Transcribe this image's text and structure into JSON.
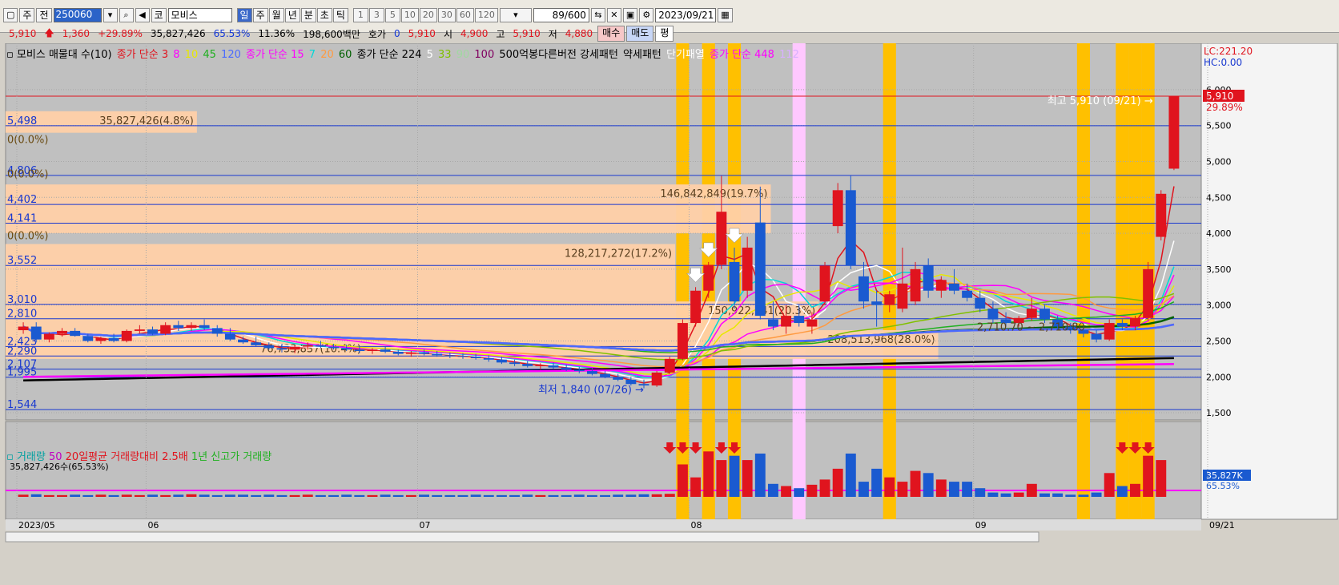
{
  "toolbar": {
    "btn_ju": "주",
    "btn_jeon": "전",
    "stock_code": "250060",
    "market_tag": "코",
    "stock_name": "모비스",
    "periods": [
      "일",
      "주",
      "월",
      "년",
      "분",
      "초",
      "틱"
    ],
    "active_period": "일",
    "numbers": [
      "1",
      "3",
      "5",
      "10",
      "20",
      "30",
      "60",
      "120"
    ],
    "count": "89/600",
    "date": "2023/09/21"
  },
  "quote": {
    "price": "5,910",
    "change": "1,360",
    "change_pct": "+29.89%",
    "volume": "35,827,426",
    "volume_pct": "65.53%",
    "turnover": "11.36%",
    "amount": "198,600백만",
    "hoga_label": "호가",
    "hoga_value": "0",
    "current": "5,910",
    "open_label": "시",
    "open": "4,900",
    "high_label": "고",
    "high": "5,910",
    "low_label": "저",
    "low": "4,880",
    "buy": "매수",
    "sell": "매도",
    "eval": "평"
  },
  "legend": [
    {
      "text": "모비스 매물대 수(10)",
      "color": "#000000"
    },
    {
      "text": "종가 단순 3",
      "color": "#e0141e"
    },
    {
      "text": "8",
      "color": "#ff00ff"
    },
    {
      "text": "10",
      "color": "#e8e800"
    },
    {
      "text": "45",
      "color": "#20b020"
    },
    {
      "text": "120",
      "color": "#4a6aff"
    },
    {
      "text": "종가 단순 15",
      "color": "#ff00ff"
    },
    {
      "text": "7",
      "color": "#00d8d8"
    },
    {
      "text": "20",
      "color": "#ff9a40"
    },
    {
      "text": "60",
      "color": "#006000"
    },
    {
      "text": "종가 단순 224",
      "color": "#000000"
    },
    {
      "text": "5",
      "color": "#ffffff"
    },
    {
      "text": "33",
      "color": "#80c000"
    },
    {
      "text": "90",
      "color": "#a0d8a0"
    },
    {
      "text": "100",
      "color": "#800060"
    },
    {
      "text": "500억봉다른버전 강세패턴",
      "color": "#000000"
    },
    {
      "text": "약세패턴",
      "color": "#000000"
    },
    {
      "text": "단기패열",
      "color": "#ffffff"
    },
    {
      "text": "종가 단순 448",
      "color": "#ff00ff"
    },
    {
      "text": "112",
      "color": "#d8b0ff"
    }
  ],
  "volume_legend": [
    {
      "text": "거래량",
      "color": "#00a0a0"
    },
    {
      "text": "50",
      "color": "#c000c0"
    },
    {
      "text": "20일평균 거래량대비 2.5배",
      "color": "#e0141e"
    },
    {
      "text": "1년 신고가 거래량",
      "color": "#20b020"
    }
  ],
  "volume_sub": "35,827,426수(65.53%)",
  "chart_data": {
    "type": "candlestick",
    "ylim": [
      1400,
      6200
    ],
    "price_ticks": [
      "1,500",
      "2,000",
      "2,500",
      "3,000",
      "3,500",
      "4,000",
      "4,500",
      "5,000",
      "5,500",
      "6,000"
    ],
    "price_tick_values": [
      1500,
      2000,
      2500,
      3000,
      3500,
      4000,
      4500,
      5000,
      5500,
      6000
    ],
    "x_labels": [
      {
        "label": "2023/05",
        "index": 0
      },
      {
        "label": "06",
        "index": 10
      },
      {
        "label": "07",
        "index": 31
      },
      {
        "label": "08",
        "index": 52
      },
      {
        "label": "09",
        "index": 74
      },
      {
        "label": "09/21",
        "index": 88
      }
    ],
    "top_right": {
      "lc": "LC:221.20",
      "hc": "HC:0.00"
    },
    "last_price_tag": "5,910",
    "last_pct_tag": "29.89%",
    "volume_tag": "35,827K",
    "volume_pct_tag": "65.53%",
    "candles": [
      {
        "o": 2650,
        "h": 2760,
        "l": 2600,
        "c": 2700
      },
      {
        "o": 2700,
        "h": 2760,
        "l": 2480,
        "c": 2520
      },
      {
        "o": 2520,
        "h": 2620,
        "l": 2480,
        "c": 2600
      },
      {
        "o": 2600,
        "h": 2680,
        "l": 2560,
        "c": 2640
      },
      {
        "o": 2640,
        "h": 2680,
        "l": 2560,
        "c": 2570
      },
      {
        "o": 2570,
        "h": 2600,
        "l": 2480,
        "c": 2500
      },
      {
        "o": 2500,
        "h": 2560,
        "l": 2460,
        "c": 2540
      },
      {
        "o": 2540,
        "h": 2600,
        "l": 2480,
        "c": 2500
      },
      {
        "o": 2500,
        "h": 2660,
        "l": 2480,
        "c": 2640
      },
      {
        "o": 2640,
        "h": 2720,
        "l": 2600,
        "c": 2660
      },
      {
        "o": 2660,
        "h": 2700,
        "l": 2580,
        "c": 2600
      },
      {
        "o": 2600,
        "h": 2760,
        "l": 2580,
        "c": 2720
      },
      {
        "o": 2720,
        "h": 2780,
        "l": 2640,
        "c": 2680
      },
      {
        "o": 2680,
        "h": 2760,
        "l": 2640,
        "c": 2720
      },
      {
        "o": 2720,
        "h": 2800,
        "l": 2650,
        "c": 2680
      },
      {
        "o": 2680,
        "h": 2720,
        "l": 2560,
        "c": 2600
      },
      {
        "o": 2600,
        "h": 2680,
        "l": 2500,
        "c": 2520
      },
      {
        "o": 2520,
        "h": 2560,
        "l": 2460,
        "c": 2480
      },
      {
        "o": 2480,
        "h": 2560,
        "l": 2420,
        "c": 2440
      },
      {
        "o": 2440,
        "h": 2480,
        "l": 2380,
        "c": 2400
      },
      {
        "o": 2400,
        "h": 2460,
        "l": 2340,
        "c": 2380
      },
      {
        "o": 2380,
        "h": 2440,
        "l": 2330,
        "c": 2420
      },
      {
        "o": 2420,
        "h": 2480,
        "l": 2380,
        "c": 2440
      },
      {
        "o": 2440,
        "h": 2500,
        "l": 2400,
        "c": 2420
      },
      {
        "o": 2420,
        "h": 2460,
        "l": 2380,
        "c": 2400
      },
      {
        "o": 2400,
        "h": 2450,
        "l": 2360,
        "c": 2380
      },
      {
        "o": 2380,
        "h": 2420,
        "l": 2330,
        "c": 2360
      },
      {
        "o": 2360,
        "h": 2400,
        "l": 2320,
        "c": 2380
      },
      {
        "o": 2380,
        "h": 2420,
        "l": 2330,
        "c": 2350
      },
      {
        "o": 2350,
        "h": 2380,
        "l": 2300,
        "c": 2320
      },
      {
        "o": 2320,
        "h": 2360,
        "l": 2280,
        "c": 2340
      },
      {
        "o": 2340,
        "h": 2380,
        "l": 2300,
        "c": 2320
      },
      {
        "o": 2320,
        "h": 2360,
        "l": 2280,
        "c": 2300
      },
      {
        "o": 2300,
        "h": 2340,
        "l": 2260,
        "c": 2290
      },
      {
        "o": 2290,
        "h": 2330,
        "l": 2250,
        "c": 2280
      },
      {
        "o": 2280,
        "h": 2320,
        "l": 2240,
        "c": 2260
      },
      {
        "o": 2260,
        "h": 2300,
        "l": 2210,
        "c": 2240
      },
      {
        "o": 2240,
        "h": 2280,
        "l": 2180,
        "c": 2200
      },
      {
        "o": 2200,
        "h": 2240,
        "l": 2150,
        "c": 2180
      },
      {
        "o": 2180,
        "h": 2220,
        "l": 2130,
        "c": 2150
      },
      {
        "o": 2150,
        "h": 2190,
        "l": 2100,
        "c": 2160
      },
      {
        "o": 2160,
        "h": 2200,
        "l": 2110,
        "c": 2130
      },
      {
        "o": 2130,
        "h": 2170,
        "l": 2080,
        "c": 2100
      },
      {
        "o": 2100,
        "h": 2140,
        "l": 2050,
        "c": 2080
      },
      {
        "o": 2080,
        "h": 2120,
        "l": 2020,
        "c": 2040
      },
      {
        "o": 2040,
        "h": 2080,
        "l": 1980,
        "c": 2000
      },
      {
        "o": 2000,
        "h": 2040,
        "l": 1940,
        "c": 1960
      },
      {
        "o": 1960,
        "h": 2000,
        "l": 1880,
        "c": 1900
      },
      {
        "o": 1900,
        "h": 1960,
        "l": 1840,
        "c": 1880
      },
      {
        "o": 1880,
        "h": 2080,
        "l": 1860,
        "c": 2060
      },
      {
        "o": 2060,
        "h": 2280,
        "l": 2040,
        "c": 2250
      },
      {
        "o": 2250,
        "h": 2800,
        "l": 2230,
        "c": 2750
      },
      {
        "o": 2750,
        "h": 3250,
        "l": 2700,
        "c": 3200
      },
      {
        "o": 3200,
        "h": 3600,
        "l": 3100,
        "c": 3560
      },
      {
        "o": 3560,
        "h": 4800,
        "l": 3500,
        "c": 4300
      },
      {
        "o": 3600,
        "h": 3800,
        "l": 2950,
        "c": 3050
      },
      {
        "o": 3200,
        "h": 3950,
        "l": 3100,
        "c": 3800
      },
      {
        "o": 4150,
        "h": 4650,
        "l": 2800,
        "c": 2850
      },
      {
        "o": 2800,
        "h": 3050,
        "l": 2650,
        "c": 2700
      },
      {
        "o": 2700,
        "h": 3000,
        "l": 2600,
        "c": 2850
      },
      {
        "o": 2850,
        "h": 3000,
        "l": 2700,
        "c": 2750
      },
      {
        "o": 2700,
        "h": 2900,
        "l": 2600,
        "c": 2800
      },
      {
        "o": 3050,
        "h": 3600,
        "l": 3000,
        "c": 3550
      },
      {
        "o": 4100,
        "h": 4700,
        "l": 4000,
        "c": 4600
      },
      {
        "o": 4600,
        "h": 4800,
        "l": 3500,
        "c": 3550
      },
      {
        "o": 3400,
        "h": 3600,
        "l": 2950,
        "c": 3050
      },
      {
        "o": 3050,
        "h": 3200,
        "l": 2700,
        "c": 3000
      },
      {
        "o": 3000,
        "h": 3200,
        "l": 2900,
        "c": 3150
      },
      {
        "o": 2950,
        "h": 3800,
        "l": 2900,
        "c": 3300
      },
      {
        "o": 3050,
        "h": 3600,
        "l": 3000,
        "c": 3500
      },
      {
        "o": 3550,
        "h": 3650,
        "l": 3100,
        "c": 3200
      },
      {
        "o": 3200,
        "h": 3400,
        "l": 3100,
        "c": 3350
      },
      {
        "o": 3300,
        "h": 3500,
        "l": 3150,
        "c": 3200
      },
      {
        "o": 3200,
        "h": 3300,
        "l": 3050,
        "c": 3100
      },
      {
        "o": 3100,
        "h": 3200,
        "l": 2900,
        "c": 2950
      },
      {
        "o": 2950,
        "h": 3050,
        "l": 2750,
        "c": 2800
      },
      {
        "o": 2800,
        "h": 2900,
        "l": 2700,
        "c": 2750
      },
      {
        "o": 2750,
        "h": 2850,
        "l": 2700,
        "c": 2820
      },
      {
        "o": 2820,
        "h": 3100,
        "l": 2780,
        "c": 2950
      },
      {
        "o": 2950,
        "h": 3000,
        "l": 2750,
        "c": 2800
      },
      {
        "o": 2800,
        "h": 2850,
        "l": 2650,
        "c": 2700
      },
      {
        "o": 2700,
        "h": 2750,
        "l": 2600,
        "c": 2650
      },
      {
        "o": 2650,
        "h": 2700,
        "l": 2550,
        "c": 2600
      },
      {
        "o": 2600,
        "h": 2650,
        "l": 2480,
        "c": 2520
      },
      {
        "o": 2520,
        "h": 2800,
        "l": 2500,
        "c": 2750
      },
      {
        "o": 2750,
        "h": 2800,
        "l": 2650,
        "c": 2700
      },
      {
        "o": 2700,
        "h": 2850,
        "l": 2650,
        "c": 2820
      },
      {
        "o": 2820,
        "h": 3600,
        "l": 2780,
        "c": 3500
      },
      {
        "o": 3950,
        "h": 4600,
        "l": 3900,
        "c": 4550
      },
      {
        "o": 4900,
        "h": 5910,
        "l": 4880,
        "c": 5910
      }
    ],
    "volume_max": 35827426,
    "volumes": [
      0.05,
      0.06,
      0.04,
      0.04,
      0.05,
      0.04,
      0.05,
      0.04,
      0.05,
      0.04,
      0.05,
      0.04,
      0.05,
      0.06,
      0.05,
      0.04,
      0.05,
      0.05,
      0.04,
      0.05,
      0.04,
      0.04,
      0.05,
      0.04,
      0.04,
      0.05,
      0.04,
      0.04,
      0.05,
      0.04,
      0.04,
      0.05,
      0.04,
      0.04,
      0.04,
      0.05,
      0.04,
      0.04,
      0.04,
      0.05,
      0.04,
      0.04,
      0.04,
      0.05,
      0.04,
      0.04,
      0.05,
      0.05,
      0.06,
      0.06,
      0.07,
      0.75,
      0.45,
      1.05,
      0.85,
      0.95,
      0.85,
      1.0,
      0.3,
      0.25,
      0.2,
      0.28,
      0.4,
      0.65,
      1.0,
      0.35,
      0.65,
      0.45,
      0.35,
      0.6,
      0.55,
      0.4,
      0.35,
      0.35,
      0.2,
      0.1,
      0.08,
      0.1,
      0.3,
      0.08,
      0.08,
      0.05,
      0.05,
      0.1,
      0.55,
      0.25,
      0.3,
      0.95,
      0.85
    ],
    "price_levels": [
      {
        "value": 5498,
        "label": "5,498"
      },
      {
        "value": 4806,
        "label": "4,806"
      },
      {
        "value": 4402,
        "label": "4,402"
      },
      {
        "value": 4141,
        "label": "4,141"
      },
      {
        "value": 3552,
        "label": "3,552"
      },
      {
        "value": 3010,
        "label": "3,010"
      },
      {
        "value": 2810,
        "label": "2,810"
      },
      {
        "value": 2423,
        "label": "2,423"
      },
      {
        "value": 2290,
        "label": "2,290"
      },
      {
        "value": 2107,
        "label": "2,107"
      },
      {
        "value": 1995,
        "label": "1,995"
      },
      {
        "value": 1544,
        "label": "1,544"
      }
    ],
    "volume_profile": [
      {
        "y1": 5700,
        "y2": 5400,
        "len": 0.16,
        "label": "35,827,426(4.8%)"
      },
      {
        "y1": 4680,
        "y2": 4000,
        "len": 0.64,
        "label": "146,842,849(19.7%)"
      },
      {
        "y1": 3850,
        "y2": 3050,
        "len": 0.56,
        "label": "128,217,272(17.2%)"
      },
      {
        "y1": 3050,
        "y2": 2650,
        "len": 0.68,
        "label": "150,922,541(20.3%)"
      },
      {
        "y1": 2650,
        "y2": 2250,
        "len": 0.78,
        "label": "208,513,968(28.0%)"
      },
      {
        "y1": 2520,
        "y2": 2300,
        "len": 0.3,
        "label": "76,733,837(10.4%)"
      }
    ],
    "zero_labels": [
      {
        "value": 5300,
        "label": "0(0.0%)"
      },
      {
        "value": 4820,
        "label": "0(0.0%)"
      },
      {
        "value": 3960,
        "label": "0(0.0%)"
      }
    ],
    "annotations": [
      {
        "text": "최고 5,910 (09/21) →",
        "value": 5910,
        "index": 88
      },
      {
        "text": "최저 1,840 (07/26) →",
        "value": 1840,
        "index": 48
      },
      {
        "text": "2,710.70 ~ 2,710.80",
        "value": 2710,
        "index": 75
      }
    ],
    "highlight_columns": [
      {
        "index": 51,
        "color": "#ffc000"
      },
      {
        "index": 53,
        "color": "#ffc000"
      },
      {
        "index": 55,
        "color": "#ffc000"
      },
      {
        "index": 60,
        "color": "#ffc8ff"
      },
      {
        "index": 67,
        "color": "#ffc000"
      },
      {
        "index": 82,
        "color": "#ffc000"
      },
      {
        "index": 85,
        "color": "#ffc000"
      },
      {
        "index": 86,
        "color": "#ffc000"
      },
      {
        "index": 87,
        "color": "#ffc000"
      }
    ],
    "signal_arrows_price": [
      52,
      53,
      55
    ],
    "signal_arrows_volume": [
      50,
      51,
      52,
      54,
      55,
      85,
      86,
      87
    ]
  }
}
